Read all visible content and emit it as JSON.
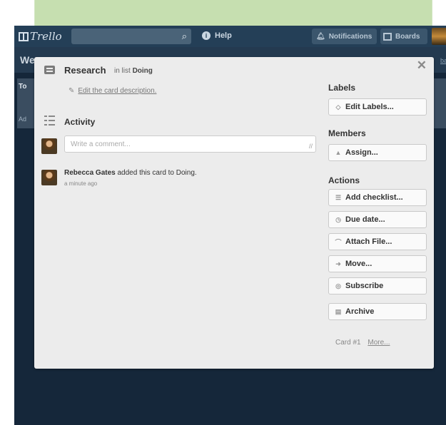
{
  "header": {
    "logo": "Trello",
    "help_label": "Help",
    "notifications_label": "Notifications",
    "boards_label": "Boards",
    "search_placeholder": ""
  },
  "board": {
    "title_fragment": "We",
    "right_link_fragment": "bar",
    "list_title_fragment": "To",
    "list_add_fragment": "Ad"
  },
  "card": {
    "title": "Research",
    "in_list_prefix": "in list",
    "list_name": "Doing",
    "edit_description": "Edit the card description.",
    "close_glyph": "✕",
    "number_label": "Card #1",
    "more_label": "More..."
  },
  "activity": {
    "heading": "Activity",
    "comment_placeholder": "Write a comment...",
    "entry_user": "Rebecca Gates",
    "entry_text": "added this card to Doing.",
    "entry_time": "a minute ago"
  },
  "sidebar": {
    "labels_heading": "Labels",
    "edit_labels": "Edit Labels...",
    "members_heading": "Members",
    "assign": "Assign...",
    "actions_heading": "Actions",
    "actions": [
      {
        "label": "Add checklist...",
        "icon": "checklist-icon"
      },
      {
        "label": "Due date...",
        "icon": "clock-icon"
      },
      {
        "label": "Attach File...",
        "icon": "paperclip-icon"
      },
      {
        "label": "Move...",
        "icon": "arrow-right-icon"
      },
      {
        "label": "Subscribe",
        "icon": "eye-icon"
      },
      {
        "label": "Archive",
        "icon": "archive-icon"
      }
    ]
  },
  "colors": {
    "app_bg": "#15273a",
    "header_bg": "#243f57",
    "modal_bg": "#ececec",
    "banner": "#c6dfb0"
  }
}
